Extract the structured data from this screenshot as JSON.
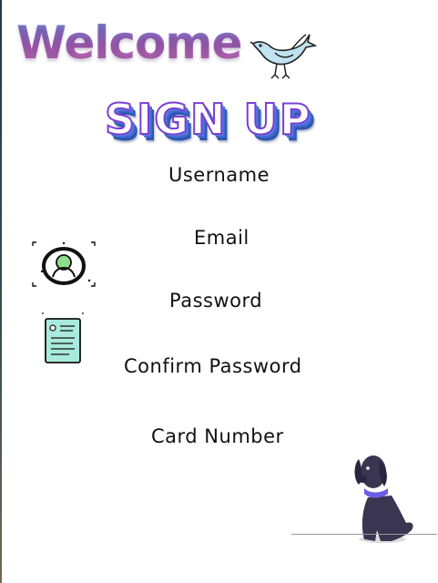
{
  "header": {
    "welcome": "Welcome",
    "signup": "SIGN UP"
  },
  "form": {
    "fields": [
      {
        "label": "Username"
      },
      {
        "label": "Email"
      },
      {
        "label": "Password"
      },
      {
        "label": "Confirm Password"
      },
      {
        "label": "Card Number"
      }
    ]
  },
  "icons": {
    "bird": "bird-icon",
    "user": "user-avatar-icon",
    "document": "document-icon",
    "dog": "dog-icon"
  },
  "colors": {
    "welcome_gradient": [
      "#6b7fd1",
      "#a25bb3",
      "#c96fb0"
    ],
    "signup_stroke": "#7a3fd6",
    "signup_shadow": "#2e56b3",
    "dog_body": "#3a3550",
    "dog_collar": "#6b5ce7",
    "accent_mint": "#a8eadb"
  }
}
